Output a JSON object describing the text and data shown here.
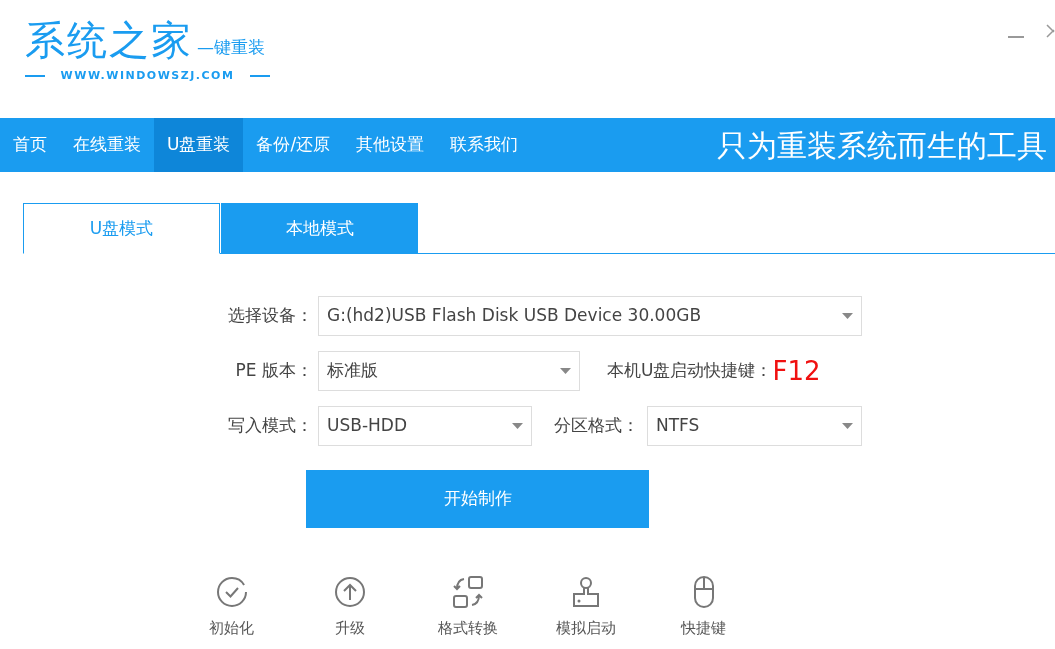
{
  "logo": {
    "name": "系统之家",
    "tagline": "—键重装",
    "url": "WWW.WINDOWSZJ.COM"
  },
  "nav": {
    "items": [
      {
        "label": "首页",
        "selected": false
      },
      {
        "label": "在线重装",
        "selected": false
      },
      {
        "label": "U盘重装",
        "selected": true
      },
      {
        "label": "备份/还原",
        "selected": false
      },
      {
        "label": "其他设置",
        "selected": false
      },
      {
        "label": "联系我们",
        "selected": false
      }
    ],
    "slogan": "只为重装系统而生的工具"
  },
  "tabs": [
    {
      "label": "U盘模式",
      "selected": true
    },
    {
      "label": "本地模式",
      "selected": false
    }
  ],
  "form": {
    "device": {
      "label": "选择设备：",
      "value": "G:(hd2)USB Flash Disk USB Device 30.00GB"
    },
    "pe_version": {
      "label": "PE 版本：",
      "value": "标准版"
    },
    "hotkey": {
      "label": "本机U盘启动快捷键：",
      "value": "F12"
    },
    "write_mode": {
      "label": "写入模式：",
      "value": "USB-HDD"
    },
    "partition": {
      "label": "分区格式：",
      "value": "NTFS"
    }
  },
  "start_button": "开始制作",
  "tools": [
    {
      "kind": "check",
      "label": "初始化"
    },
    {
      "kind": "upload",
      "label": "升级"
    },
    {
      "kind": "convert",
      "label": "格式转换"
    },
    {
      "kind": "stamp",
      "label": "模拟启动"
    },
    {
      "kind": "mouse",
      "label": "快捷键"
    }
  ]
}
